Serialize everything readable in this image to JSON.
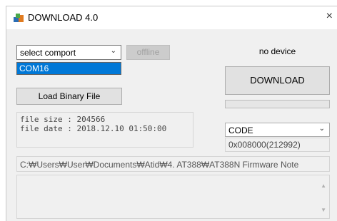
{
  "window": {
    "title": "DOWNLOAD 4.0",
    "close_glyph": "×",
    "app_icon": "download-app-icon"
  },
  "comport": {
    "selected": "select comport",
    "options": [
      "COM16"
    ],
    "highlighted": "COM16"
  },
  "offline_label": "offline",
  "device_status": "no device",
  "download_label": "DOWNLOAD",
  "progress_fraction": 0,
  "load_label": "Load Binary File",
  "file_info": {
    "size": "file size : 204566",
    "date": "file date : 2018.12.10 01:50:00"
  },
  "code": {
    "selected": "CODE",
    "address": "0x008000(212992)"
  },
  "path": "C:₩Users₩User₩Documents₩Atid₩4. AT388₩AT388N Firmware Note",
  "colors": {
    "selection": "#0078d7",
    "progress": "#06b025"
  }
}
